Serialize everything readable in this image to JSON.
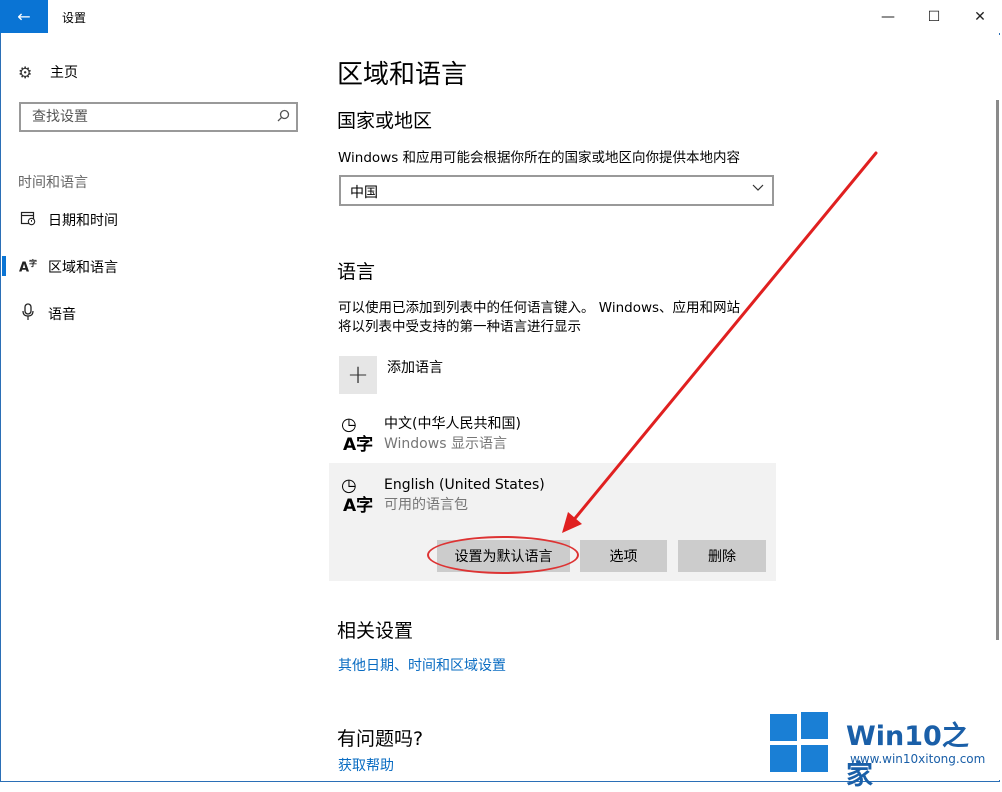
{
  "window": {
    "title": "设置",
    "back_icon": "←",
    "min_icon": "—",
    "max_icon": "☐",
    "close_icon": "✕"
  },
  "sidebar": {
    "home_label": "主页",
    "search_placeholder": "查找设置",
    "section_title": "时间和语言",
    "items": [
      {
        "label": "日期和时间",
        "icon": "calendar-clock-icon"
      },
      {
        "label": "区域和语言",
        "icon": "region-language-icon",
        "active": true
      },
      {
        "label": "语音",
        "icon": "microphone-icon"
      }
    ]
  },
  "main": {
    "title": "区域和语言",
    "region": {
      "heading": "国家或地区",
      "description": "Windows 和应用可能会根据你所在的国家或地区向你提供本地内容",
      "selected": "中国"
    },
    "language": {
      "heading": "语言",
      "description_line1": "可以使用已添加到列表中的任何语言键入。 Windows、应用和网站",
      "description_line2": "将以列表中受支持的第一种语言进行显示",
      "add_label": "添加语言",
      "items": [
        {
          "name": "中文(中华人民共和国)",
          "status": "Windows 显示语言"
        },
        {
          "name": "English (United States)",
          "status": "可用的语言包"
        }
      ],
      "buttons": {
        "set_default": "设置为默认语言",
        "options": "选项",
        "remove": "删除"
      }
    },
    "related": {
      "heading": "相关设置",
      "link": "其他日期、时间和区域设置"
    },
    "help": {
      "heading": "有问题吗?",
      "link": "获取帮助"
    }
  },
  "watermark": {
    "brand_en": "Win10",
    "brand_zh": "之家",
    "url": "www.win10xitong.com"
  },
  "colors": {
    "accent": "#0a74d4",
    "annotation": "#d33333",
    "link": "#0a6cc2"
  }
}
